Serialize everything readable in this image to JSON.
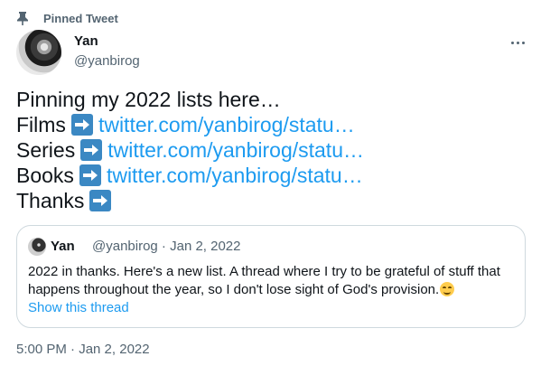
{
  "pinned": {
    "label": "Pinned Tweet"
  },
  "author": {
    "name": "Yan",
    "handle": "@yanbirog"
  },
  "tweet": {
    "lines": [
      {
        "text": "Pinning my 2022 lists here…"
      },
      {
        "text": "Films",
        "emoji": "arrow-right-icon",
        "link": "twitter.com/yanbirog/statu…"
      },
      {
        "text": "Series",
        "emoji": "arrow-right-icon",
        "link": "twitter.com/yanbirog/statu…"
      },
      {
        "text": "Books",
        "emoji": "arrow-right-icon",
        "link": "twitter.com/yanbirog/statu…"
      },
      {
        "text": "Thanks",
        "emoji": "arrow-right-icon"
      }
    ]
  },
  "quote": {
    "name": "Yan",
    "meta": "@yanbirog · Jan 2, 2022",
    "text": "2022 in thanks. Here's a new list. A thread where I try to  be grateful of stuff that happens throughout the year, so I don't lose sight of God's provision.",
    "emoji": "smiling-face-icon",
    "show_thread": "Show this thread"
  },
  "timestamp": "5:00 PM · Jan 2, 2022",
  "colors": {
    "link": "#1d9bf0",
    "secondary_text": "#536471",
    "border": "#cfd9de",
    "emoji_blue": "#3b88c3"
  }
}
